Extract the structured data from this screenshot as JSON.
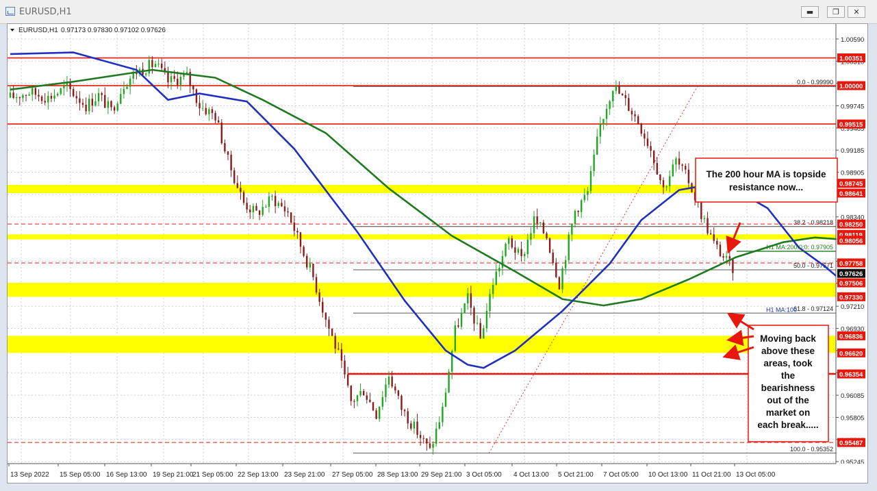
{
  "window": {
    "title": "EURUSD,H1",
    "buttons": {
      "minimize": "▬",
      "restore": "❐",
      "close": "✕"
    }
  },
  "chart_data": {
    "type": "candlestick",
    "header": {
      "symbol": "EURUSD,H1",
      "ohlc": "0.97173 0.97830 0.97102 0.97626"
    },
    "ylim": [
      0.9522,
      1.0078
    ],
    "y_ticks": [
      "1.00590",
      "1.00310",
      "1.00030",
      "0.99745",
      "0.99465",
      "0.99185",
      "0.98905",
      "0.98625",
      "0.98340",
      "0.98060",
      "0.97780",
      "0.97500",
      "0.97210",
      "0.96930",
      "0.96650",
      "0.96370",
      "0.96085",
      "0.95805",
      "0.95525",
      "0.95245"
    ],
    "x_labels": [
      "13 Sep 2022",
      "15 Sep 05:00",
      "16 Sep 13:00",
      "19 Sep 21:00",
      "21 Sep 05:00",
      "22 Sep 13:00",
      "23 Sep 21:00",
      "27 Sep 05:00",
      "28 Sep 13:00",
      "29 Sep 21:00",
      "3 Oct 05:00",
      "4 Oct 13:00",
      "5 Oct 21:00",
      "7 Oct 05:00",
      "10 Oct 13:00",
      "11 Oct 21:00",
      "13 Oct 05:00"
    ],
    "bars_count": 230,
    "price_path": [
      [
        0,
        0.9985
      ],
      [
        6,
        0.9992
      ],
      [
        12,
        0.9985
      ],
      [
        18,
        0.9998
      ],
      [
        24,
        0.9975
      ],
      [
        28,
        0.9988
      ],
      [
        32,
        0.9968
      ],
      [
        36,
        1.0002
      ],
      [
        40,
        1.0018
      ],
      [
        46,
        1.0028
      ],
      [
        50,
        1.0005
      ],
      [
        56,
        1.0012
      ],
      [
        60,
        0.9975
      ],
      [
        65,
        0.9962
      ],
      [
        69,
        0.9905
      ],
      [
        74,
        0.9852
      ],
      [
        78,
        0.9838
      ],
      [
        83,
        0.9858
      ],
      [
        88,
        0.984
      ],
      [
        92,
        0.9798
      ],
      [
        96,
        0.9758
      ],
      [
        100,
        0.9705
      ],
      [
        104,
        0.966
      ],
      [
        108,
        0.96
      ],
      [
        112,
        0.9615
      ],
      [
        116,
        0.9585
      ],
      [
        120,
        0.9635
      ],
      [
        124,
        0.9592
      ],
      [
        128,
        0.9568
      ],
      [
        133,
        0.9538
      ],
      [
        137,
        0.959
      ],
      [
        141,
        0.969
      ],
      [
        145,
        0.973
      ],
      [
        149,
        0.968
      ],
      [
        153,
        0.9752
      ],
      [
        158,
        0.9805
      ],
      [
        162,
        0.978
      ],
      [
        166,
        0.983
      ],
      [
        170,
        0.981
      ],
      [
        174,
        0.975
      ],
      [
        179,
        0.9842
      ],
      [
        183,
        0.9865
      ],
      [
        187,
        0.995
      ],
      [
        191,
        1.0
      ],
      [
        195,
        0.998
      ],
      [
        199,
        0.9955
      ],
      [
        203,
        0.992
      ],
      [
        207,
        0.987
      ],
      [
        211,
        0.9905
      ],
      [
        215,
        0.988
      ],
      [
        219,
        0.9838
      ],
      [
        223,
        0.98
      ],
      [
        227,
        0.9778
      ],
      [
        231,
        0.976
      ],
      [
        235,
        0.9725
      ],
      [
        240,
        0.9718
      ],
      [
        244,
        0.9708
      ],
      [
        249,
        0.969
      ],
      [
        253,
        0.9706
      ],
      [
        257,
        0.976
      ],
      [
        261,
        0.97
      ],
      [
        265,
        0.9718
      ],
      [
        270,
        0.969
      ],
      [
        275,
        0.9708
      ],
      [
        280,
        0.971
      ],
      [
        283,
        0.9695
      ],
      [
        286,
        0.9762
      ]
    ],
    "moving_averages": [
      {
        "name": "H1 MA:200:0:0",
        "label": "H1 MA:200:0:0: 0.97905",
        "color": "#1f7a1f",
        "points": [
          [
            0,
            0.9995
          ],
          [
            20,
            1.0005
          ],
          [
            45,
            1.002
          ],
          [
            65,
            1.001
          ],
          [
            80,
            0.9982
          ],
          [
            100,
            0.994
          ],
          [
            120,
            0.987
          ],
          [
            140,
            0.981
          ],
          [
            160,
            0.9765
          ],
          [
            175,
            0.973
          ],
          [
            188,
            0.9722
          ],
          [
            200,
            0.973
          ],
          [
            215,
            0.9755
          ],
          [
            230,
            0.9783
          ],
          [
            245,
            0.9802
          ],
          [
            255,
            0.9808
          ],
          [
            265,
            0.9805
          ],
          [
            275,
            0.9798
          ],
          [
            286,
            0.97905
          ]
        ]
      },
      {
        "name": "H1 MA:100",
        "label": "H1 MA:100",
        "color": "#1f2fbf",
        "points": [
          [
            0,
            1.004
          ],
          [
            20,
            1.0042
          ],
          [
            40,
            1.002
          ],
          [
            50,
            0.9982
          ],
          [
            60,
            0.999
          ],
          [
            75,
            0.998
          ],
          [
            90,
            0.992
          ],
          [
            110,
            0.9815
          ],
          [
            125,
            0.9728
          ],
          [
            138,
            0.9665
          ],
          [
            145,
            0.9647
          ],
          [
            150,
            0.9643
          ],
          [
            160,
            0.9665
          ],
          [
            175,
            0.9715
          ],
          [
            190,
            0.9775
          ],
          [
            200,
            0.983
          ],
          [
            212,
            0.9868
          ],
          [
            222,
            0.9875
          ],
          [
            230,
            0.9868
          ],
          [
            240,
            0.9845
          ],
          [
            250,
            0.9795
          ],
          [
            258,
            0.9772
          ],
          [
            266,
            0.9745
          ],
          [
            276,
            0.9725
          ],
          [
            286,
            0.9712
          ]
        ]
      }
    ],
    "fibonacci": [
      {
        "level_label": "0.0 - 0.99990",
        "value": 0.9999
      },
      {
        "level_label": "38.2 - 0.98218",
        "value": 0.98218
      },
      {
        "level_label": "50.0 - 0.97671",
        "value": 0.97671
      },
      {
        "level_label": "61.8 - 0.97124",
        "value": 0.97124
      },
      {
        "level_label": "100.0 - 0.95352",
        "value": 0.95352
      }
    ],
    "yellow_zones": [
      {
        "from": 0.98641,
        "to": 0.98745
      },
      {
        "from": 0.98056,
        "to": 0.98119
      },
      {
        "from": 0.9733,
        "to": 0.97506
      },
      {
        "from": 0.9662,
        "to": 0.96836
      }
    ],
    "red_lines": [
      {
        "value": 1.00351,
        "style": "solid"
      },
      {
        "value": 1.0,
        "style": "solid"
      },
      {
        "value": 0.99515,
        "style": "solid"
      },
      {
        "value": 0.9825,
        "style": "dashed"
      },
      {
        "value": 0.97758,
        "style": "dashed"
      },
      {
        "value": 0.96354,
        "style": "solid-thick"
      },
      {
        "value": 0.95487,
        "style": "dashed"
      }
    ],
    "price_tags": [
      {
        "text": "1.00351",
        "value": 1.00351,
        "bg": "#e8170c",
        "fg": "#ffffff"
      },
      {
        "text": "1.00000",
        "value": 1.0,
        "bg": "#e8170c",
        "fg": "#ffffff"
      },
      {
        "text": "0.99515",
        "value": 0.99515,
        "bg": "#e8170c",
        "fg": "#ffffff"
      },
      {
        "text": "0.98745",
        "value": 0.98765,
        "bg": "#e8170c",
        "fg": "#ffffff"
      },
      {
        "text": "0.98641",
        "value": 0.98641,
        "bg": "#e8170c",
        "fg": "#ffffff"
      },
      {
        "text": "0.98250",
        "value": 0.9825,
        "bg": "#e8170c",
        "fg": "#ffffff"
      },
      {
        "text": "0.98119",
        "value": 0.98119,
        "bg": "#e8170c",
        "fg": "#ffffff"
      },
      {
        "text": "0.98056",
        "value": 0.98045,
        "bg": "#e8170c",
        "fg": "#ffffff"
      },
      {
        "text": "0.97758",
        "value": 0.97758,
        "bg": "#e8170c",
        "fg": "#ffffff"
      },
      {
        "text": "0.97626",
        "value": 0.97626,
        "bg": "#111111",
        "fg": "#ffffff"
      },
      {
        "text": "0.97506",
        "value": 0.97506,
        "bg": "#e8170c",
        "fg": "#ffffff"
      },
      {
        "text": "0.97330",
        "value": 0.9733,
        "bg": "#e8170c",
        "fg": "#ffffff"
      },
      {
        "text": "0.96836",
        "value": 0.96836,
        "bg": "#e8170c",
        "fg": "#ffffff"
      },
      {
        "text": "0.96620",
        "value": 0.9662,
        "bg": "#e8170c",
        "fg": "#ffffff"
      },
      {
        "text": "0.96354",
        "value": 0.96354,
        "bg": "#e8170c",
        "fg": "#ffffff"
      },
      {
        "text": "0.95487",
        "value": 0.95487,
        "bg": "#e8170c",
        "fg": "#ffffff"
      }
    ],
    "annotations": [
      {
        "text": "The 200 hour MA is topside resistance now...",
        "lines": [
          "The 200 hour MA is topside",
          "resistance now..."
        ]
      },
      {
        "text": "Moving back above these areas, took the bearishness out of the market on each break.....",
        "lines": [
          "Moving back",
          "above these",
          "areas, took",
          "the",
          "bearishness",
          "out of the",
          "market on",
          "each break....."
        ]
      }
    ],
    "colors": {
      "bull": "#1fa81f",
      "bear": "#8b1a1a",
      "zone": "#ffff00",
      "level": "#e8170c",
      "background": "#ffffff",
      "grid": "#c8d0dc"
    }
  }
}
